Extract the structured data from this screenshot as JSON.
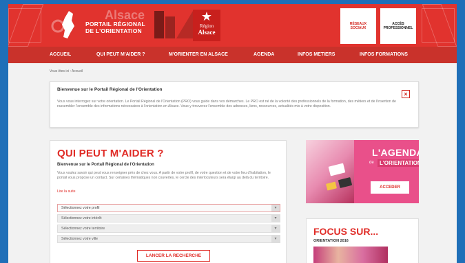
{
  "header": {
    "logo_watermark": "Alsace",
    "logo_line1": "PORTAIL RÉGIONAL",
    "logo_line2": "DE L'ORIENTATION",
    "region_line1": "Région",
    "region_line2": "Alsace",
    "btn_reseaux": "RÉSEAUX SOCIAUX",
    "btn_acces": "ACCÈS PROFESSIONNEL"
  },
  "nav": {
    "items": [
      "ACCUEIL",
      "QUI PEUT M'AIDER ?",
      "M'ORIENTER EN ALSACE",
      "AGENDA",
      "INFOS METIERS",
      "INFOS FORMATIONS"
    ]
  },
  "breadcrumb": "Vous êtes ici : Accueil",
  "welcome": {
    "title": "Bienvenue sur le Portail Régional de l'Orientation",
    "text": "Vous vous interrogez sur votre orientation. Le Portail Régional de l'Orientation (PRO) vous guide dans vos démarches. Le PRO est né de la volonté des professionnels de la formation, des métiers et de l'insertion de rassembler l'ensemble des informations nécessaires à l'orientation en Alsace. Vous y trouverez l'ensemble des adresses, liens, ressources, actualités mis à votre disposition."
  },
  "qpm": {
    "title": "QUI PEUT M'AIDER ?",
    "subtitle": "Bienvenue sur le Portail Régional de l'Orientation",
    "desc": "Vous voulez savoir qui peut vous renseigner près de chez vous. A partir de votre profil, de votre question et de votre lieu d'habitation, le portail vous propose un contact. Sur certaines thématiques non couvertes, le cercle des interlocuteurs sera élargi au delà du territoire.",
    "more": "Lire la suite",
    "selects": [
      "Sélectionnez votre profil",
      "Sélectionnez votre intérêt",
      "Sélectionnez votre territoire",
      "Sélectionnez votre ville"
    ],
    "search": "LANCER LA RECHERCHE"
  },
  "agenda": {
    "title": "L'AGENDA",
    "de": "de",
    "orientation": "L'ORIENTATION",
    "btn": "ACCEDER"
  },
  "focus": {
    "title": "FOCUS SUR...",
    "subtitle": "ORIENTATION 2016"
  },
  "colors": {
    "brand_red": "#e1332e",
    "nav_red": "#c9322b",
    "agenda_pink": "#e9508a",
    "frame_blue": "#1f6fb8"
  }
}
